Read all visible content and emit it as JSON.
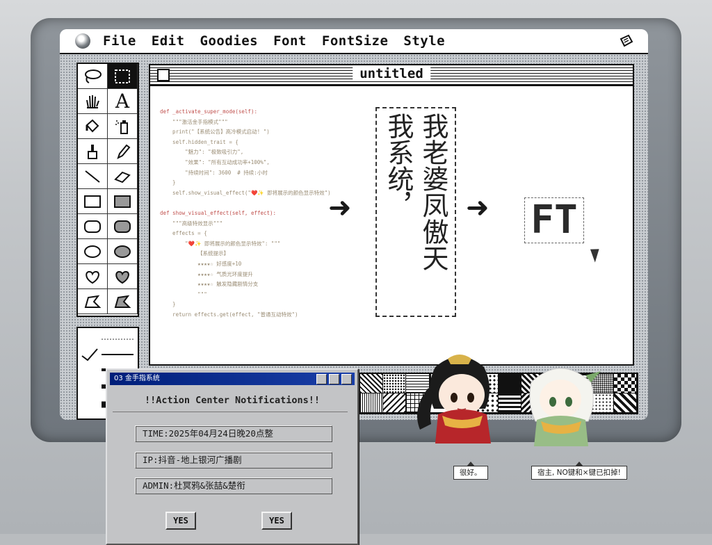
{
  "menubar": {
    "items": [
      "File",
      "Edit",
      "Goodies",
      "Font",
      "FontSize",
      "Style"
    ]
  },
  "document": {
    "title": "untitled",
    "code_lines": [
      "def _activate_super_mode(self):",
      "    \"\"\"激活金手指模式\"\"\"",
      "    print(\"【系统公告】高冷模式启动! \")",
      "    self.hidden_trait = {",
      "        \"魅力\": \"极致吸引力\",",
      "        \"效果\": \"所有互动成功率+100%\",",
      "        \"持续时间\": 3600  # 持续:小时",
      "    }",
      "    self.show_visual_effect(\"❤️✨ 即将展示的颜色显示特效\")",
      "",
      "def show_visual_effect(self, effect):",
      "    \"\"\"高级特效显示\"\"\"",
      "    effects = {",
      "        \"❤️✨ 即将展示的颜色显示特效\": \"\"\"",
      "            【系统提示】",
      "            ★★★★☆ 好感度+10",
      "            ★★★★☆ 气质光环度提升",
      "            ★★★★☆ 触发隐藏剧情分支",
      "            \"\"\"",
      "    }",
      "    return effects.get(effect, \"普通互动特效\")"
    ],
    "vertical_col_left": "我系统，",
    "vertical_col_right": "我老婆凤傲天",
    "logo_text": "FT",
    "arrow_glyph": "➜"
  },
  "dialog": {
    "title": "03 金手指系统",
    "heading": "!!Action Center Notifications!!",
    "time": "TIME:2025年04月24日晚20点整",
    "ip": "IP:抖音-地上银河广播剧",
    "admin": "ADMIN:杜冥鸦&张喆&楚衔",
    "yes1": "YES",
    "yes2": "YES"
  },
  "characters": {
    "left_bubble": "很好。",
    "right_bubble": "宿主, NO键和×键已扣掉!"
  },
  "colors": {
    "dialog_titlebar": "#001f7a",
    "code_text": "#9a8c74",
    "heart": "#d62a2a"
  },
  "icons": [
    "lasso-icon",
    "select-rect-icon",
    "hand-icon",
    "text-icon",
    "paint-bucket-icon",
    "spray-icon",
    "brush-icon",
    "pencil-icon",
    "line-icon",
    "eraser-icon",
    "rect-icon",
    "filled-rect-icon",
    "rounded-rect-icon",
    "filled-rounded-rect-icon",
    "oval-icon",
    "filled-oval-icon",
    "freeform-icon",
    "filled-freeform-icon",
    "polygon-icon",
    "filled-polygon-icon"
  ]
}
